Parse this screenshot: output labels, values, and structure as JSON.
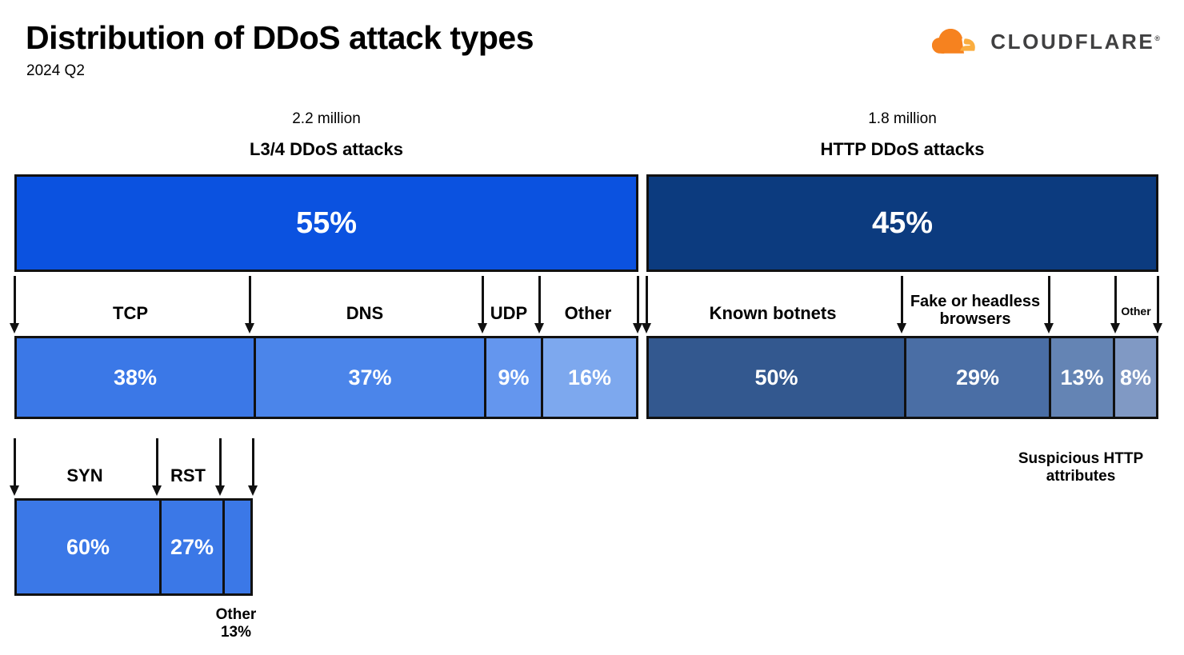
{
  "header": {
    "title": "Distribution of DDoS attack types",
    "subtitle": "2024 Q2"
  },
  "brand": {
    "name": "CLOUDFLARE",
    "logo_icon": "cloudflare-cloud-icon",
    "cloud_color": "#f6821f",
    "cloud_shadow_color": "#faad3f",
    "wordmark_color": "#404041"
  },
  "columns": [
    {
      "count": "2.2 million",
      "title": "L3/4 DDoS attacks"
    },
    {
      "count": "1.8 million",
      "title": "HTTP DDoS attacks"
    }
  ],
  "labels": {
    "tcp": "TCP",
    "dns": "DNS",
    "udp": "UDP",
    "other_l34": "Other",
    "syn": "SYN",
    "rst": "RST",
    "other_tcp": "Other\n13%",
    "known_botnets": "Known botnets",
    "fake_browsers": "Fake or headless\nbrowsers",
    "other_http": "Other",
    "suspicious_http": "Suspicious HTTP\nattributes"
  },
  "chart_data": {
    "type": "bar",
    "title": "Distribution of DDoS attack types",
    "subtitle": "2024 Q2",
    "orientation": "horizontal-stacked-hierarchical",
    "units": "percent",
    "grid": false,
    "legend": "none",
    "levels": [
      {
        "name": "Attack layer",
        "categories": [
          "L3/4 DDoS attacks",
          "HTTP DDoS attacks"
        ],
        "values": [
          55,
          45
        ],
        "value_labels": [
          "55%",
          "45%"
        ],
        "counts": [
          "2.2 million",
          "1.8 million"
        ],
        "colors": [
          "#0b52e0",
          "#0c3b7f"
        ]
      },
      {
        "name": "L3/4 attack vectors",
        "parent": "L3/4 DDoS attacks",
        "categories": [
          "TCP",
          "DNS",
          "UDP",
          "Other"
        ],
        "values": [
          38,
          37,
          9,
          16
        ],
        "value_labels": [
          "38%",
          "37%",
          "9%",
          "16%"
        ],
        "colors": [
          "#3b78e7",
          "#4b85ea",
          "#6496ee",
          "#7da8ee"
        ]
      },
      {
        "name": "TCP attack vectors",
        "parent": "TCP",
        "categories": [
          "SYN",
          "RST",
          "Other"
        ],
        "values": [
          60,
          27,
          13
        ],
        "value_labels": [
          "60%",
          "27%",
          "13%"
        ],
        "colors": [
          "#3b78e7",
          "#3b78e7",
          "#3b78e7"
        ]
      },
      {
        "name": "HTTP attack vectors",
        "parent": "HTTP DDoS attacks",
        "categories": [
          "Known botnets",
          "Fake or headless browsers",
          "Suspicious HTTP attributes",
          "Other"
        ],
        "values": [
          50,
          29,
          13,
          8
        ],
        "value_labels": [
          "50%",
          "29%",
          "13%",
          "8%"
        ],
        "colors": [
          "#33588f",
          "#4a6ea5",
          "#6484b4",
          "#8099c4"
        ]
      }
    ]
  }
}
